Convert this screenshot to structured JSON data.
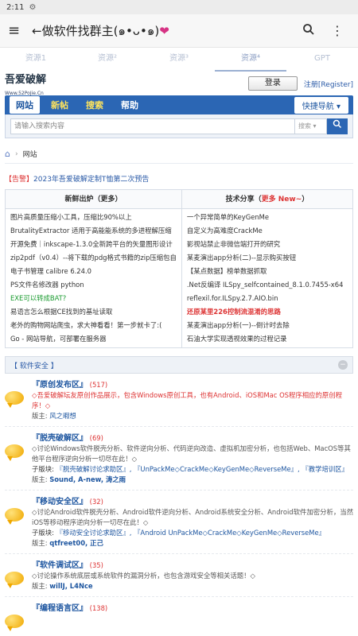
{
  "status": {
    "time": "2:11",
    "icon": "gear-icon"
  },
  "appbar": {
    "menu_icon": "menu-icon",
    "title": "←做软件找群主(๑•ᴗ•๑)",
    "heart": "❤",
    "search_icon": "search-icon",
    "more_icon": "more-vert-icon"
  },
  "tabs": [
    {
      "label": "资源1",
      "active": false
    },
    {
      "label": "资源²",
      "active": false
    },
    {
      "label": "资源³",
      "active": false
    },
    {
      "label": "资源⁴",
      "active": true
    },
    {
      "label": "GPT",
      "active": false
    }
  ],
  "site": {
    "logo": "吾爱破解",
    "logo_sub": "Www.52PoJie.Cn",
    "login": "登录",
    "register_a": "注册",
    "register_b": "[Register]"
  },
  "nav": {
    "items": [
      "网站",
      "新帖",
      "搜索",
      "帮助"
    ],
    "quick": "快捷导航 ▾"
  },
  "search": {
    "placeholder": "请输入搜索内容",
    "select": "搜索 ▾",
    "button_icon": "search-icon"
  },
  "breadcrumb": {
    "current": "网站"
  },
  "notice": {
    "tag": "【告警】",
    "text": "2023年吾爱破解定制T恤第二次预告"
  },
  "left_list": {
    "title": "新鲜出炉（更多）",
    "items": [
      "图片高质量压缩小工具，压缩比90%以上",
      "BrutalityExtractor 适用于高能能系统的多进程解压缩",
      "开源免费｜inkscape-1.3.0全新跨平台的矢量图形设计",
      "zip2pdf（v0.4）--将下载的pdg格式书籍的zip压缩包自",
      "电子书管理 calibre 6.24.0",
      "PS文件名修改器 python",
      "EXE可以转成BAT?",
      "易语言怎么根据CE找到的基址读取",
      "老外的购物网站爬虫，求大神看看！第一步就卡了:(",
      "Go - 网站导航，可部署在服务器"
    ]
  },
  "right_list": {
    "title_a": "技术分享（",
    "title_b": "更多 New~",
    "title_c": "）",
    "items": [
      "一个异常简单的KeyGenMe",
      "自定义为高难度CrackMe",
      "影视站禁止非微信端打开的研究",
      "某麦演出app分析(二)--显示购买按钮",
      "【某点数据】榜单数据抓取",
      ".Net反编译 ILSpy_selfcontained_8.1.0.7455-x64",
      "reflexil.for.ILSpy.2.7.AIO.bin",
      "还原某里226控制流混淆的思路",
      "某麦演出app分析(一)--倒计时去除",
      "石油大学实现透视效果的过程记录"
    ]
  },
  "section": {
    "title": "【 软件安全 】",
    "collapse_icon": "collapse-icon"
  },
  "forums": [
    {
      "name": "『原创发布区』",
      "count": "(517)",
      "desc": "◇吾爱破解坛友原创作品展示，包含Windows原创工具，也有Android、iOS和Mac OS程序相应的原创程序！◇",
      "desc_red": true,
      "sub_label": "",
      "sub": "",
      "mod_label": "版主: ",
      "mods": "风之暇想"
    },
    {
      "name": "『脱壳破解区』",
      "count": "(69)",
      "desc": "◇讨论Windows软件脱壳分析、软件逆向分析、代码逆向改造、虚拟机加密分析，也包括Web、MacOS等其他平台程序逆向分析一切尽在此！◇",
      "desc_red": false,
      "sub_label": "子版块: ",
      "sub": "『脱壳破解讨论求助区』, 『UnPackMe◇CrackMe◇KeyGenMe◇ReverseMe』, 『教学培训区』",
      "mod_label": "版主: ",
      "mods": "Sound, A-new, 涛之雨"
    },
    {
      "name": "『移动安全区』",
      "count": "(32)",
      "desc": "◇讨论Android软件脱壳分析、Android软件逆向分析、Android系统安全分析、Android软件加密分析，当然iOS等移动程序逆向分析一切尽在此！◇",
      "desc_red": false,
      "sub_label": "子版块: ",
      "sub": "『移动安全讨论求助区』, 『Android UnPackMe◇CrackMe◇KeyGenMe◇ReverseMe』",
      "mod_label": "版主: ",
      "mods": "qtfreet00, 正己"
    },
    {
      "name": "『软件调试区』",
      "count": "(35)",
      "desc": "◇讨论操作系统底层或系统软件的漏洞分析，也包含游戏安全等相关话题！◇",
      "desc_red": false,
      "sub_label": "",
      "sub": "",
      "mod_label": "版主: ",
      "mods": "willJ, L4Nce"
    },
    {
      "name": "『编程语言区』",
      "count": "(138)",
      "desc": "",
      "desc_red": false,
      "sub_label": "",
      "sub": "",
      "mod_label": "",
      "mods": ""
    }
  ]
}
